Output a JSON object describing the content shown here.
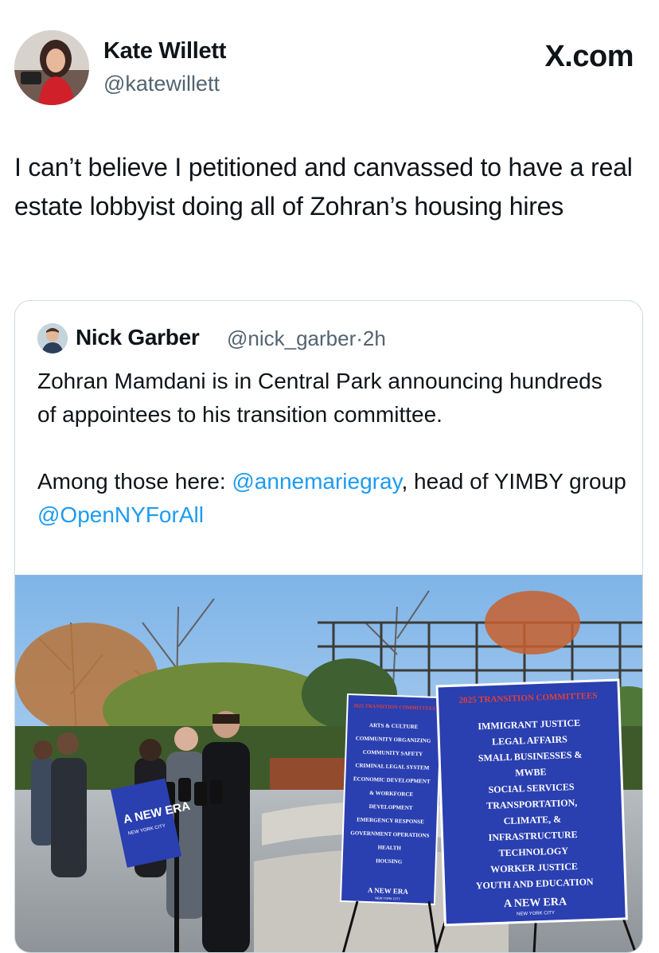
{
  "author": {
    "name": "Kate Willett",
    "handle": "@katewillett"
  },
  "brand": {
    "logo_text": "X.com"
  },
  "tweet": {
    "text": "I can’t believe I petitioned and canvassed to have a real estate lobbyist doing all of Zohran’s housing hires"
  },
  "quoted": {
    "name": "Nick Garber",
    "handle": "@nick_garber",
    "separator": "·",
    "time": "2h",
    "paragraph1": "Zohran Mamdani is in Central Park announcing hundreds of appointees to his transition committee.",
    "p2_prefix": "Among those here: ",
    "mention1": "@annemariegray",
    "p2_middle": ", head of YIMBY group ",
    "mention2": "@OpenNYForAll"
  },
  "photo": {
    "sign_left": {
      "title": "2025 TRANSITION COMMITTEES",
      "items": [
        "ARTS & CULTURE",
        "COMMUNITY ORGANIZING",
        "COMMUNITY SAFETY",
        "CRIMINAL LEGAL SYSTEM",
        "ECONOMIC DEVELOPMENT",
        "& WORKFORCE",
        "DEVELOPMENT",
        "EMERGENCY RESPONSE",
        "GOVERNMENT OPERATIONS",
        "HEALTH",
        "HOUSING"
      ],
      "footer": "A NEW ERA",
      "footer_sub": "NEW YORK CITY"
    },
    "sign_right": {
      "title": "2025 TRANSITION COMMITTEES",
      "items": [
        "IMMIGRANT JUSTICE",
        "LEGAL AFFAIRS",
        "SMALL BUSINESSES &",
        "MWBE",
        "SOCIAL SERVICES",
        "TRANSPORTATION,",
        "CLIMATE, &",
        "INFRASTRUCTURE",
        "TECHNOLOGY",
        "WORKER JUSTICE",
        "YOUTH AND EDUCATION"
      ],
      "footer": "A NEW ERA",
      "footer_sub": "NEW YORK CITY"
    },
    "podium_sign": {
      "line1": "A NEW ERA",
      "line2": "NEW YORK CITY"
    }
  },
  "colors": {
    "mention": "#1d9bf0",
    "sign_blue": "#2a3fb0",
    "sign_title": "#e0403a"
  }
}
